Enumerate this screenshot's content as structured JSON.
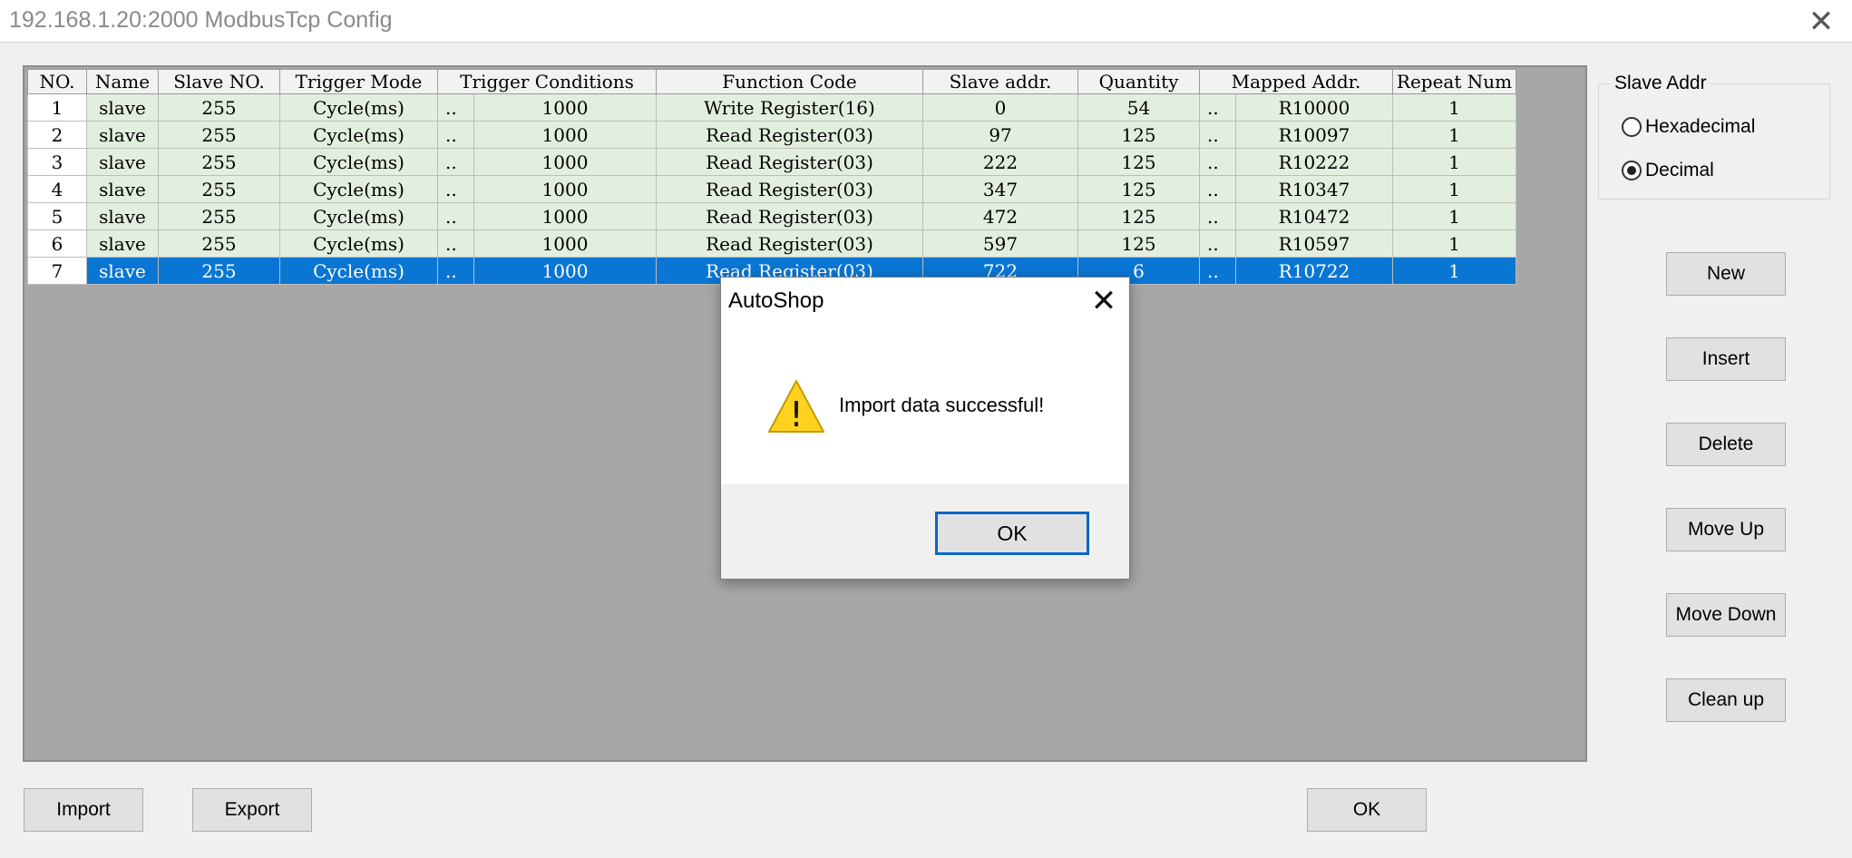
{
  "window": {
    "title": "192.168.1.20:2000 ModbusTcp Config",
    "close_glyph": "✕"
  },
  "grid": {
    "columns": [
      "NO.",
      "Name",
      "Slave NO.",
      "Trigger Mode",
      "Trigger Conditions",
      "Function Code",
      "Slave addr.",
      "Quantity",
      "Mapped Addr.",
      "Repeat Num"
    ],
    "rows": [
      {
        "no": "1",
        "name": "slave",
        "slave_no": "255",
        "trigger_mode": "Cycle(ms)",
        "trig_dots": "..",
        "trigger_cond": "1000",
        "function_code": "Write Register(16)",
        "slave_addr": "0",
        "quantity": "54",
        "map_dots": "..",
        "mapped_addr": "R10000",
        "repeat": "1"
      },
      {
        "no": "2",
        "name": "slave",
        "slave_no": "255",
        "trigger_mode": "Cycle(ms)",
        "trig_dots": "..",
        "trigger_cond": "1000",
        "function_code": "Read Register(03)",
        "slave_addr": "97",
        "quantity": "125",
        "map_dots": "..",
        "mapped_addr": "R10097",
        "repeat": "1"
      },
      {
        "no": "3",
        "name": "slave",
        "slave_no": "255",
        "trigger_mode": "Cycle(ms)",
        "trig_dots": "..",
        "trigger_cond": "1000",
        "function_code": "Read Register(03)",
        "slave_addr": "222",
        "quantity": "125",
        "map_dots": "..",
        "mapped_addr": "R10222",
        "repeat": "1"
      },
      {
        "no": "4",
        "name": "slave",
        "slave_no": "255",
        "trigger_mode": "Cycle(ms)",
        "trig_dots": "..",
        "trigger_cond": "1000",
        "function_code": "Read Register(03)",
        "slave_addr": "347",
        "quantity": "125",
        "map_dots": "..",
        "mapped_addr": "R10347",
        "repeat": "1"
      },
      {
        "no": "5",
        "name": "slave",
        "slave_no": "255",
        "trigger_mode": "Cycle(ms)",
        "trig_dots": "..",
        "trigger_cond": "1000",
        "function_code": "Read Register(03)",
        "slave_addr": "472",
        "quantity": "125",
        "map_dots": "..",
        "mapped_addr": "R10472",
        "repeat": "1"
      },
      {
        "no": "6",
        "name": "slave",
        "slave_no": "255",
        "trigger_mode": "Cycle(ms)",
        "trig_dots": "..",
        "trigger_cond": "1000",
        "function_code": "Read Register(03)",
        "slave_addr": "597",
        "quantity": "125",
        "map_dots": "..",
        "mapped_addr": "R10597",
        "repeat": "1"
      },
      {
        "no": "7",
        "name": "slave",
        "slave_no": "255",
        "trigger_mode": "Cycle(ms)",
        "trig_dots": "..",
        "trigger_cond": "1000",
        "function_code": "Read Register(03)",
        "slave_addr": "722",
        "quantity": "6",
        "map_dots": "..",
        "mapped_addr": "R10722",
        "repeat": "1"
      }
    ],
    "selected_row": 7
  },
  "slave_addr_group": {
    "label": "Slave Addr",
    "options": [
      {
        "label": "Hexadecimal",
        "checked": false
      },
      {
        "label": "Decimal",
        "checked": true
      }
    ]
  },
  "side_buttons": {
    "new": "New",
    "insert": "Insert",
    "delete": "Delete",
    "move_up": "Move Up",
    "move_down": "Move Down",
    "clean_up": "Clean up"
  },
  "bottom_buttons": {
    "import": "Import",
    "export": "Export",
    "ok": "OK"
  },
  "dialog": {
    "title": "AutoShop",
    "close_glyph": "✕",
    "message": "Import data successful!",
    "icon": "warning-icon",
    "icon_glyph": "!",
    "ok": "OK"
  },
  "colors": {
    "selected_row": "#0a76d3",
    "row_fill": "#e2efdf",
    "grid_background": "#a7a7a7",
    "warning_icon": "#ffd21f",
    "focus_border": "#0a66c8"
  }
}
